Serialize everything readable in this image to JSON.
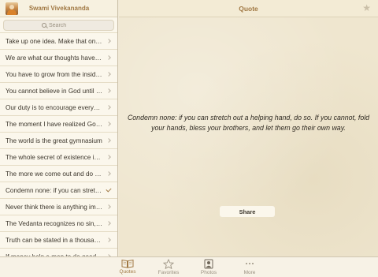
{
  "sidebar": {
    "title": "Swami Vivekananda",
    "search_placeholder": "Search",
    "items": [
      {
        "label": "Take up one idea. Make that one idea your life",
        "selected": false
      },
      {
        "label": "We are what our thoughts have made us",
        "selected": false
      },
      {
        "label": "You have to grow from the inside out",
        "selected": false
      },
      {
        "label": "You cannot believe in God until you believe in yourself",
        "selected": false
      },
      {
        "label": "Our duty is to encourage everyone in his struggle",
        "selected": false
      },
      {
        "label": "The moment I have realized God sitting in the temple",
        "selected": false
      },
      {
        "label": "The world is the great gymnasium",
        "selected": false
      },
      {
        "label": "The whole secret of existence is to have no fear",
        "selected": false
      },
      {
        "label": "The more we come out and do good to others",
        "selected": false
      },
      {
        "label": "Condemn none: if you can stretch out a helping hand",
        "selected": true
      },
      {
        "label": "Never think there is anything impossible for the soul",
        "selected": false
      },
      {
        "label": "The Vedanta recognizes no sin, it only recognizes error",
        "selected": false
      },
      {
        "label": "Truth can be stated in a thousand different ways",
        "selected": false
      },
      {
        "label": "If money help a man to do good to others",
        "selected": false
      }
    ]
  },
  "detail": {
    "title": "Quote",
    "quote": "Condemn none: if you can stretch out a helping hand, do so. If you cannot, fold your hands, bless your brothers, and let them go their own way.",
    "share_label": "Share"
  },
  "tabbar": {
    "tabs": [
      {
        "label": "Quotes",
        "icon": "book-icon",
        "active": true
      },
      {
        "label": "Favorites",
        "icon": "star-icon",
        "active": false
      },
      {
        "label": "Photos",
        "icon": "photo-icon",
        "active": false
      },
      {
        "label": "More",
        "icon": "more-icon",
        "active": false
      }
    ]
  },
  "colors": {
    "accent": "#a07843",
    "paper": "#efe6cf",
    "sidebar_bg": "#fbf7ec"
  }
}
